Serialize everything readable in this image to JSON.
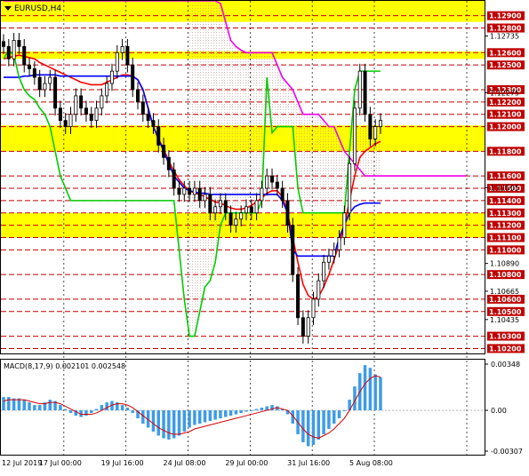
{
  "header": {
    "symbol_label": "EURUSD,H4"
  },
  "macd": {
    "label": "MACD(8,17,9) 0.002101 0.002548",
    "y_ticks": [
      "0.00348",
      "0.00",
      "-0.00307"
    ]
  },
  "colors": {
    "resistance_line": "#c00000",
    "highlight_zone": "#ffff00",
    "price_label_bg": "#c00000",
    "price_label_text": "#ffffff",
    "candle": "#000000",
    "ma_red": "#ff0000",
    "ma_blue": "#0000ff",
    "ma_green": "#00cc00",
    "ma_magenta": "#ee00ee",
    "macd_hist": "#3d9be9",
    "macd_signal": "#d40000",
    "ichimoku_cloud": "#c08080"
  },
  "chart_data": [
    {
      "type": "candlestick",
      "title": "EURUSD,H4",
      "x_tick_labels": [
        "12 Jul 2019",
        "17 Jul 00:00",
        "19 Jul 16:00",
        "24 Jul 08:00",
        "29 Jul 00:00",
        "31 Jul 16:00",
        "5 Aug 08:00"
      ],
      "ylim": [
        1.1016,
        1.1302
      ],
      "y_tick_labels": [
        "1.12735",
        "1.12275",
        "1.11505",
        "1.10890",
        "1.10665",
        "1.10435"
      ],
      "highlighted_levels": [
        "1.12900",
        "1.12800",
        "1.12600",
        "1.12500",
        "1.12300",
        "1.12200",
        "1.12100",
        "1.12000",
        "1.11800",
        "1.11600",
        "1.11500",
        "1.11400",
        "1.11300",
        "1.11200",
        "1.11100",
        "1.11000",
        "1.10800",
        "1.10600",
        "1.10500",
        "1.10300",
        "1.10200"
      ],
      "highlight_zones": [
        [
          1.1285,
          1.1302
        ],
        [
          1.1255,
          1.1261
        ],
        [
          1.118,
          1.1201
        ],
        [
          1.111,
          1.113
        ]
      ],
      "series": [
        {
          "name": "close",
          "values": [
            1.1265,
            1.1255,
            1.127,
            1.1265,
            1.125,
            1.1247,
            1.124,
            1.123,
            1.1235,
            1.124,
            1.1215,
            1.1205,
            1.12,
            1.121,
            1.1225,
            1.1215,
            1.121,
            1.1205,
            1.1215,
            1.1225,
            1.1235,
            1.1245,
            1.126,
            1.1265,
            1.125,
            1.123,
            1.122,
            1.121,
            1.1205,
            1.12,
            1.1185,
            1.1175,
            1.1165,
            1.115,
            1.1145,
            1.115,
            1.1145,
            1.115,
            1.114,
            1.1145,
            1.113,
            1.1135,
            1.114,
            1.113,
            1.112,
            1.1125,
            1.113,
            1.1135,
            1.113,
            1.114,
            1.115,
            1.116,
            1.1155,
            1.115,
            1.114,
            1.112,
            1.108,
            1.1045,
            1.103,
            1.1045,
            1.106,
            1.1075,
            1.109,
            1.1095,
            1.11,
            1.111,
            1.113,
            1.117,
            1.1215,
            1.1245,
            1.121,
            1.119,
            1.12,
            1.1205
          ]
        },
        {
          "name": "ma_red",
          "values": [
            1.1255,
            1.1256,
            1.1257,
            1.1258,
            1.1257,
            1.1256,
            1.1255,
            1.1252,
            1.125,
            1.1248,
            1.1246,
            1.1244,
            1.1242,
            1.124,
            1.1238,
            1.1236,
            1.1235,
            1.1234,
            1.1234,
            1.1234,
            1.1236,
            1.1238,
            1.124,
            1.1242,
            1.1242,
            1.1241,
            1.1238,
            1.123,
            1.1215,
            1.12,
            1.119,
            1.1182,
            1.1172,
            1.1164,
            1.1157,
            1.1152,
            1.1148,
            1.1146,
            1.1145,
            1.1143,
            1.1141,
            1.1139,
            1.1138,
            1.1136,
            1.1134,
            1.1133,
            1.1133,
            1.1134,
            1.1136,
            1.1139,
            1.1142,
            1.1146,
            1.1148,
            1.1148,
            1.1143,
            1.113,
            1.111,
            1.109,
            1.1072,
            1.1063,
            1.106,
            1.1062,
            1.107,
            1.108,
            1.1092,
            1.1105,
            1.112,
            1.114,
            1.116,
            1.1175,
            1.118,
            1.1183,
            1.1186,
            1.1188
          ]
        },
        {
          "name": "ma_blue",
          "values": [
            1.124,
            1.124,
            1.124,
            1.124,
            1.1241,
            1.1241,
            1.1242,
            1.1242,
            1.1242,
            1.1242,
            1.1242,
            1.1241,
            1.1241,
            1.1241,
            1.1241,
            1.1241,
            1.1241,
            1.1241,
            1.1241,
            1.1241,
            1.1241,
            1.1241,
            1.1241,
            1.1241,
            1.1241,
            1.1241,
            1.1238,
            1.123,
            1.1215,
            1.12,
            1.119,
            1.118,
            1.117,
            1.116,
            1.1155,
            1.115,
            1.1148,
            1.1147,
            1.1146,
            1.1146,
            1.1145,
            1.1145,
            1.1145,
            1.1145,
            1.1145,
            1.1145,
            1.1145,
            1.1145,
            1.1145,
            1.1145,
            1.1145,
            1.1145,
            1.1145,
            1.1145,
            1.114,
            1.113,
            1.11,
            1.1095,
            1.1095,
            1.1095,
            1.1095,
            1.1095,
            1.1095,
            1.1095,
            1.1095,
            1.111,
            1.112,
            1.113,
            1.1135,
            1.1137,
            1.1138,
            1.1138,
            1.1138,
            1.1138
          ]
        },
        {
          "name": "ma_green",
          "values": [
            1.1255,
            1.1262,
            1.1258,
            1.124,
            1.123,
            1.1225,
            1.1222,
            1.1215,
            1.121,
            1.12,
            1.118,
            1.116,
            1.115,
            1.114,
            1.114,
            1.114,
            1.114,
            1.114,
            1.114,
            1.114,
            1.114,
            1.114,
            1.114,
            1.114,
            1.114,
            1.114,
            1.114,
            1.114,
            1.114,
            1.114,
            1.114,
            1.114,
            1.114,
            1.114,
            1.11,
            1.106,
            1.103,
            1.103,
            1.105,
            1.107,
            1.1075,
            1.109,
            1.112,
            1.113,
            1.113,
            1.113,
            1.113,
            1.113,
            1.113,
            1.113,
            1.114,
            1.124,
            1.1195,
            1.12,
            1.12,
            1.12,
            1.12,
            1.115,
            1.113,
            1.113,
            1.113,
            1.113,
            1.113,
            1.113,
            1.113,
            1.113,
            1.113,
            1.118,
            1.123,
            1.1245,
            1.1245,
            1.1245,
            1.1245,
            1.1245
          ]
        },
        {
          "name": "ma_magenta",
          "values": [
            1.1302,
            1.1302,
            1.1302,
            1.1302,
            1.1302,
            1.1302,
            1.1302,
            1.1302,
            1.1302,
            1.1302,
            1.1302,
            1.1302,
            1.1302,
            1.1302,
            1.1302,
            1.1302,
            1.1302,
            1.1302,
            1.1302,
            1.1302,
            1.1302,
            1.1302,
            1.1302,
            1.1302,
            1.1302,
            1.1302,
            1.1302,
            1.1302,
            1.1302,
            1.1302,
            1.1302,
            1.1302,
            1.1302,
            1.1302,
            1.1302,
            1.1302,
            1.1302,
            1.1302,
            1.1302,
            1.1302,
            1.1302,
            1.1302,
            1.13,
            1.1285,
            1.127,
            1.1265,
            1.1262,
            1.126,
            1.126,
            1.126,
            1.126,
            1.126,
            1.126,
            1.125,
            1.124,
            1.1235,
            1.123,
            1.122,
            1.121,
            1.121,
            1.121,
            1.121,
            1.1205,
            1.12,
            1.12,
            1.119,
            1.118,
            1.1175,
            1.117,
            1.1165,
            1.116,
            1.116,
            1.116,
            1.116
          ]
        }
      ]
    },
    {
      "type": "bar",
      "title": "MACD(8,17,9) 0.002101 0.002548",
      "ylim": [
        -0.00307,
        0.00348
      ],
      "series": [
        {
          "name": "macd_histogram",
          "values": [
            0.001,
            0.001,
            0.0009,
            0.0009,
            0.0008,
            0.0006,
            0.0004,
            0.0004,
            0.0006,
            0.0008,
            0.0007,
            0.0004,
            0.0001,
            -0.0002,
            -0.0004,
            -0.0005,
            -0.0004,
            -0.0002,
            0.0001,
            0.0004,
            0.0006,
            0.0007,
            0.0006,
            0.0004,
            0.0002,
            -0.0002,
            -0.0006,
            -0.001,
            -0.0013,
            -0.0016,
            -0.0019,
            -0.0021,
            -0.0022,
            -0.0021,
            -0.0019,
            -0.0016,
            -0.0013,
            -0.0011,
            -0.001,
            -0.0009,
            -0.0008,
            -0.0007,
            -0.0006,
            -0.0005,
            -0.0004,
            -0.0003,
            -0.0002,
            -0.0001,
            0.0,
            0.0001,
            0.0002,
            0.0003,
            0.0004,
            0.0003,
            0.0001,
            -0.0003,
            -0.001,
            -0.0018,
            -0.0024,
            -0.0027,
            -0.0026,
            -0.0022,
            -0.0018,
            -0.0014,
            -0.001,
            -0.0006,
            0.0,
            0.0008,
            0.0018,
            0.0028,
            0.0034,
            0.0032,
            0.0027,
            0.0025
          ]
        },
        {
          "name": "macd_signal",
          "values": [
            0.0007,
            0.0008,
            0.0008,
            0.0008,
            0.0008,
            0.0007,
            0.0006,
            0.0005,
            0.0005,
            0.0006,
            0.0006,
            0.0005,
            0.0003,
            0.0001,
            -0.0001,
            -0.0003,
            -0.0003,
            -0.0003,
            -0.0002,
            0.0,
            0.0002,
            0.0004,
            0.0005,
            0.0005,
            0.0004,
            0.0002,
            -0.0001,
            -0.0004,
            -0.0007,
            -0.001,
            -0.0013,
            -0.0015,
            -0.0017,
            -0.0018,
            -0.0018,
            -0.0017,
            -0.0016,
            -0.0014,
            -0.0013,
            -0.0012,
            -0.0011,
            -0.001,
            -0.0009,
            -0.0008,
            -0.0007,
            -0.0006,
            -0.0005,
            -0.0004,
            -0.0003,
            -0.0002,
            -0.0001,
            0.0,
            0.0001,
            0.0002,
            0.0001,
            0.0,
            -0.0004,
            -0.0009,
            -0.0014,
            -0.0018,
            -0.002,
            -0.0021,
            -0.0019,
            -0.0017,
            -0.0014,
            -0.001,
            -0.0006,
            0.0,
            0.0007,
            0.0014,
            0.002,
            0.0024,
            0.0026,
            0.0025
          ]
        }
      ]
    }
  ]
}
